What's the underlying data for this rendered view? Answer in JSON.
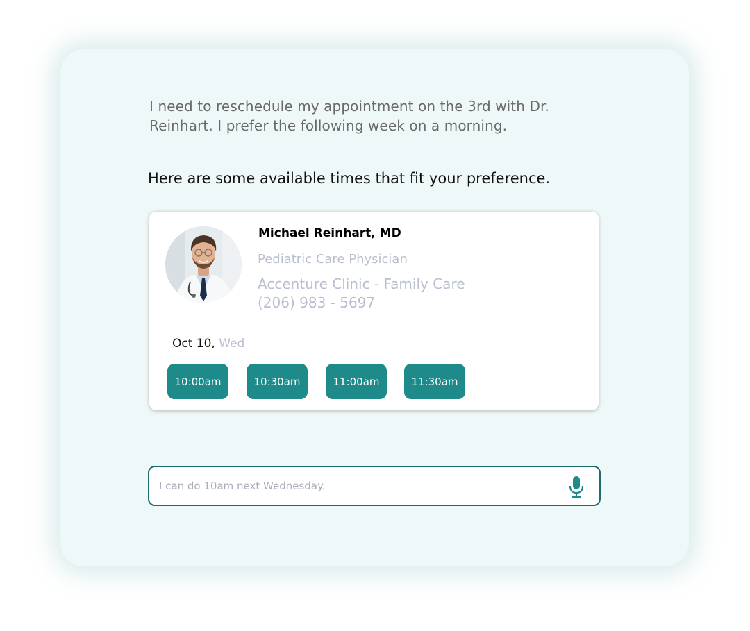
{
  "colors": {
    "panel_bg": "#eff8f8",
    "accent": "#1e8a8a",
    "input_border": "#1d6c6c",
    "muted_text": "#b9bed0"
  },
  "chat": {
    "user_message": "I need to reschedule my appointment on the 3rd with Dr. Reinhart. I prefer the following week on a morning.",
    "bot_message": "Here are some available times that fit your preference."
  },
  "doctor": {
    "name": "Michael Reinhart, MD",
    "title": "Pediatric Care Physician",
    "clinic": "Accenture Clinic - Family Care",
    "phone": "(206) 983 - 5697",
    "avatar_icon": "doctor-portrait"
  },
  "schedule": {
    "date": "Oct 10,",
    "weekday": "Wed",
    "slots": [
      "10:00am",
      "10:30am",
      "11:00am",
      "11:30am"
    ]
  },
  "input": {
    "placeholder": "I can do 10am next Wednesday.",
    "mic_icon": "microphone-icon"
  }
}
